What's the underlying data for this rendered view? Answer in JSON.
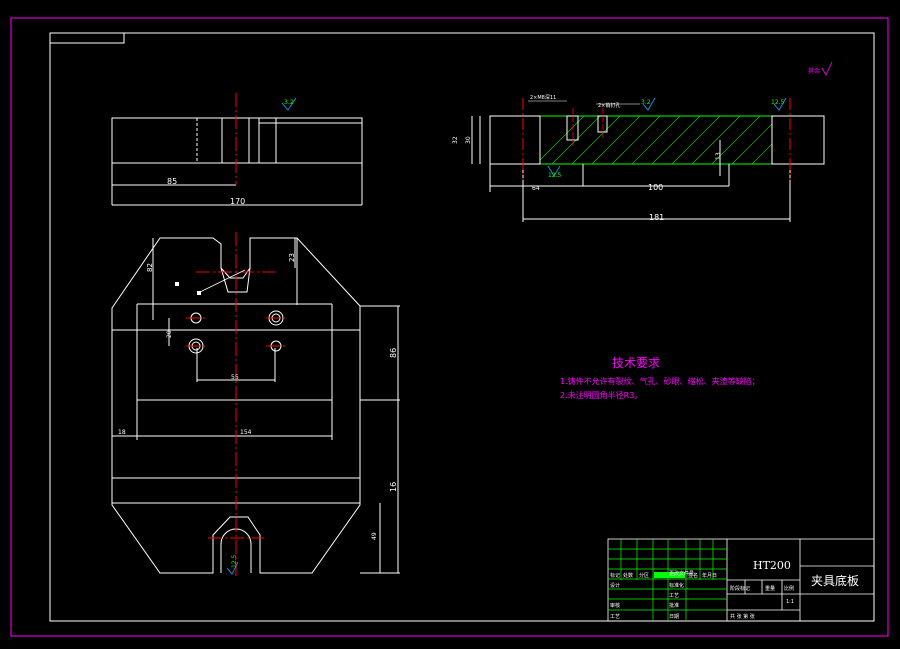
{
  "general_roughness": {
    "text": "其余"
  },
  "front_view": {
    "roughness": "3.2",
    "dim_85": "85",
    "dim_170": "170"
  },
  "section_view": {
    "note_hole1": "2×M8深11",
    "note_hole2": "2×销钉孔",
    "roughness_a": "3.2",
    "roughness_b": "12.5",
    "roughness_c": "12.5",
    "dim_32": "32",
    "dim_30": "30",
    "dim_13": "13",
    "dim_64": "64",
    "dim_100": "100",
    "dim_181": "181"
  },
  "top_view": {
    "dim_82": "82",
    "dim_23": "23",
    "dim_20": "20",
    "dim_55": "55",
    "dim_86": "86",
    "dim_18": "18",
    "dim_154": "154",
    "dim_16": "16",
    "dim_49": "49",
    "roughness": "12.5"
  },
  "requirements": {
    "title": "技术要求",
    "items": [
      "1.铸件不允许有裂纹、气孔、砂眼、缩松、夹渣等缺陷；",
      "2.未注明圆角半径R3。"
    ]
  },
  "title_block": {
    "label_mark": "标记",
    "label_count": "处数",
    "label_zone": "分区",
    "label_docno": "更改文件号",
    "label_sign": "签名",
    "label_year": "年月日",
    "label_design": "设计",
    "label_std": "标准化",
    "label_review": "审核",
    "label_process": "工艺",
    "label_approve": "批准",
    "label_craft": "工艺",
    "label_date": "日期",
    "material": "HT200",
    "label_stage": "阶段标记",
    "label_weight": "重量",
    "label_scale": "比例",
    "scale": "1:1",
    "label_sheets": "共 张 第 张",
    "part_name": "夹具底板"
  }
}
